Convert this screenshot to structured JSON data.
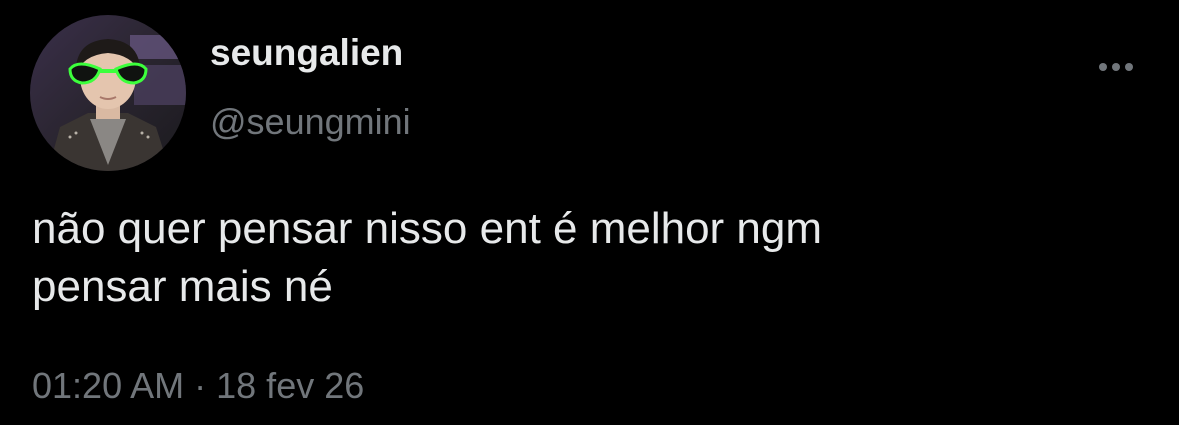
{
  "author": {
    "display_name": "seungalien",
    "handle": "@seungmini",
    "avatar": "profile-photo"
  },
  "tweet": {
    "text_lines": [
      "não quer pensar nisso ent é melhor ngm",
      "pensar mais né"
    ],
    "time": "01:20 AM",
    "separator": "·",
    "date": "18 fev 26"
  },
  "icons": {
    "more": "more-horizontal-icon"
  },
  "colors": {
    "background": "#000000",
    "primary_text": "#e7e9ea",
    "secondary_text": "#71767b"
  }
}
